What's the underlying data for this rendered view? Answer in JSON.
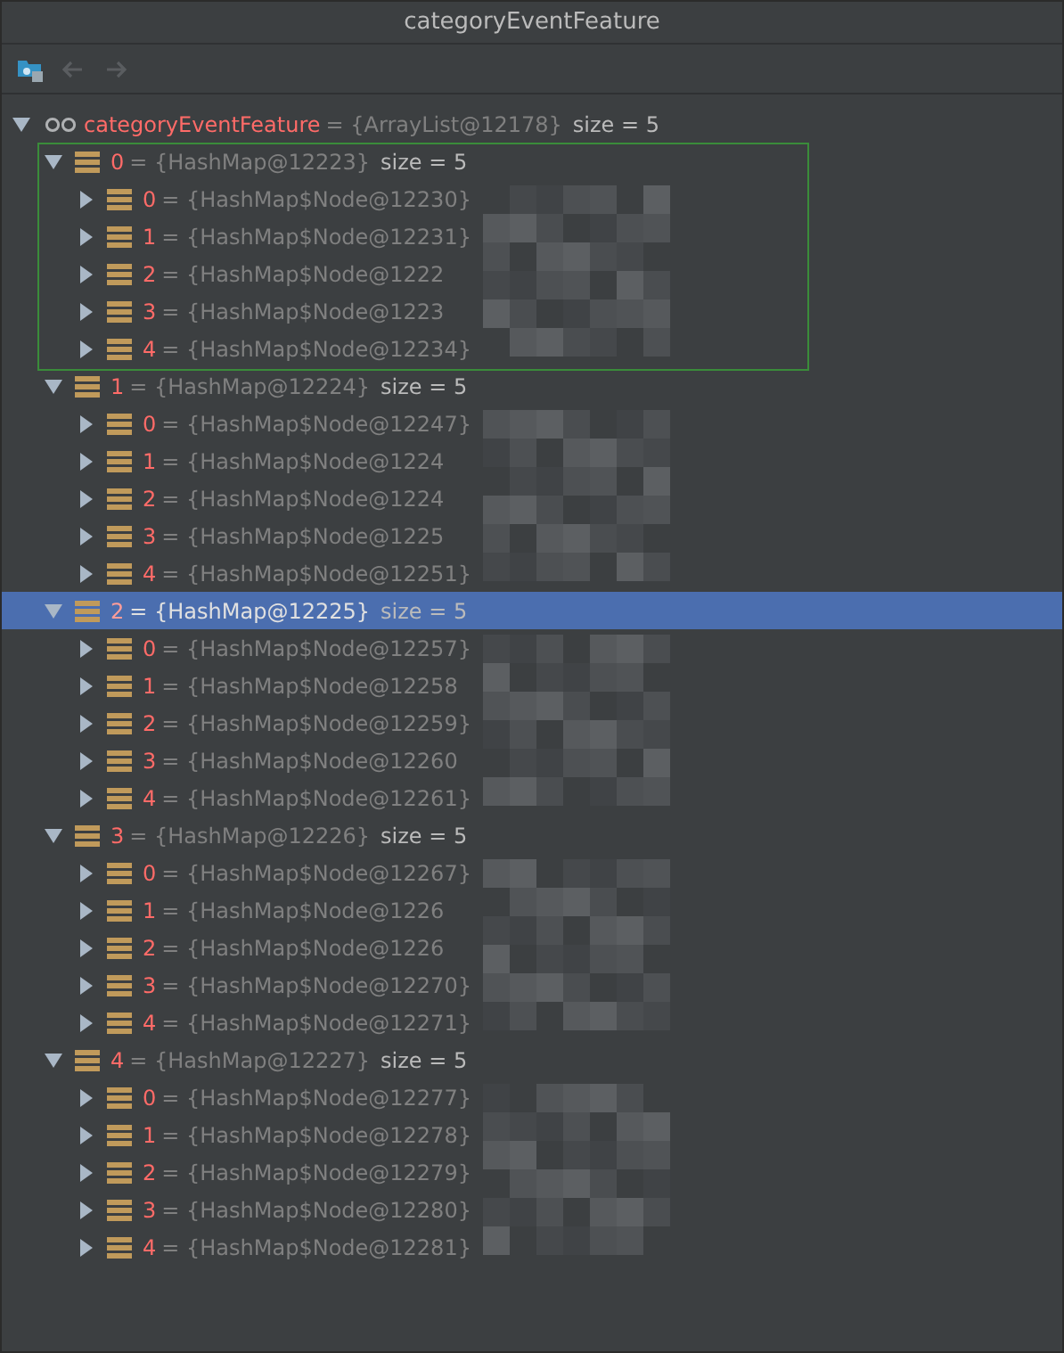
{
  "window": {
    "title": "categoryEventFeature"
  },
  "toolbar": [
    {
      "kind": "folder",
      "disabled": false
    },
    {
      "kind": "back",
      "disabled": true
    },
    {
      "kind": "forward",
      "disabled": true
    }
  ],
  "root": {
    "name": "categoryEventFeature",
    "value": "= {ArrayList@12178}",
    "size": "size = 5",
    "expanded": true,
    "children": [
      {
        "index": "0",
        "value": "= {HashMap@12223}",
        "size": "size = 5",
        "expanded": true,
        "selected": false,
        "outlined": true,
        "children": [
          {
            "index": "0",
            "value": "= {HashMap$Node@12230}"
          },
          {
            "index": "1",
            "value": "= {HashMap$Node@12231}"
          },
          {
            "index": "2",
            "value": "= {HashMap$Node@1222"
          },
          {
            "index": "3",
            "value": "= {HashMap$Node@1223"
          },
          {
            "index": "4",
            "value": "= {HashMap$Node@12234}"
          }
        ]
      },
      {
        "index": "1",
        "value": "= {HashMap@12224}",
        "size": "size = 5",
        "expanded": true,
        "selected": false,
        "outlined": false,
        "children": [
          {
            "index": "0",
            "value": "= {HashMap$Node@12247}"
          },
          {
            "index": "1",
            "value": "= {HashMap$Node@1224"
          },
          {
            "index": "2",
            "value": "= {HashMap$Node@1224"
          },
          {
            "index": "3",
            "value": "= {HashMap$Node@1225"
          },
          {
            "index": "4",
            "value": "= {HashMap$Node@12251}"
          }
        ]
      },
      {
        "index": "2",
        "value": "= {HashMap@12225}",
        "size": "size = 5",
        "expanded": true,
        "selected": true,
        "outlined": false,
        "children": [
          {
            "index": "0",
            "value": "= {HashMap$Node@12257}"
          },
          {
            "index": "1",
            "value": "= {HashMap$Node@12258"
          },
          {
            "index": "2",
            "value": "= {HashMap$Node@12259}"
          },
          {
            "index": "3",
            "value": "= {HashMap$Node@12260"
          },
          {
            "index": "4",
            "value": "= {HashMap$Node@12261}"
          }
        ]
      },
      {
        "index": "3",
        "value": "= {HashMap@12226}",
        "size": "size = 5",
        "expanded": true,
        "selected": false,
        "outlined": false,
        "children": [
          {
            "index": "0",
            "value": "= {HashMap$Node@12267}"
          },
          {
            "index": "1",
            "value": "= {HashMap$Node@1226"
          },
          {
            "index": "2",
            "value": "= {HashMap$Node@1226"
          },
          {
            "index": "3",
            "value": "= {HashMap$Node@12270}"
          },
          {
            "index": "4",
            "value": "= {HashMap$Node@12271}"
          }
        ]
      },
      {
        "index": "4",
        "value": "= {HashMap@12227}",
        "size": "size = 5",
        "expanded": true,
        "selected": false,
        "outlined": false,
        "children": [
          {
            "index": "0",
            "value": "= {HashMap$Node@12277}"
          },
          {
            "index": "1",
            "value": "= {HashMap$Node@12278}"
          },
          {
            "index": "2",
            "value": "= {HashMap$Node@12279}"
          },
          {
            "index": "3",
            "value": "= {HashMap$Node@12280}"
          },
          {
            "index": "4",
            "value": "= {HashMap$Node@12281}"
          }
        ]
      }
    ]
  }
}
